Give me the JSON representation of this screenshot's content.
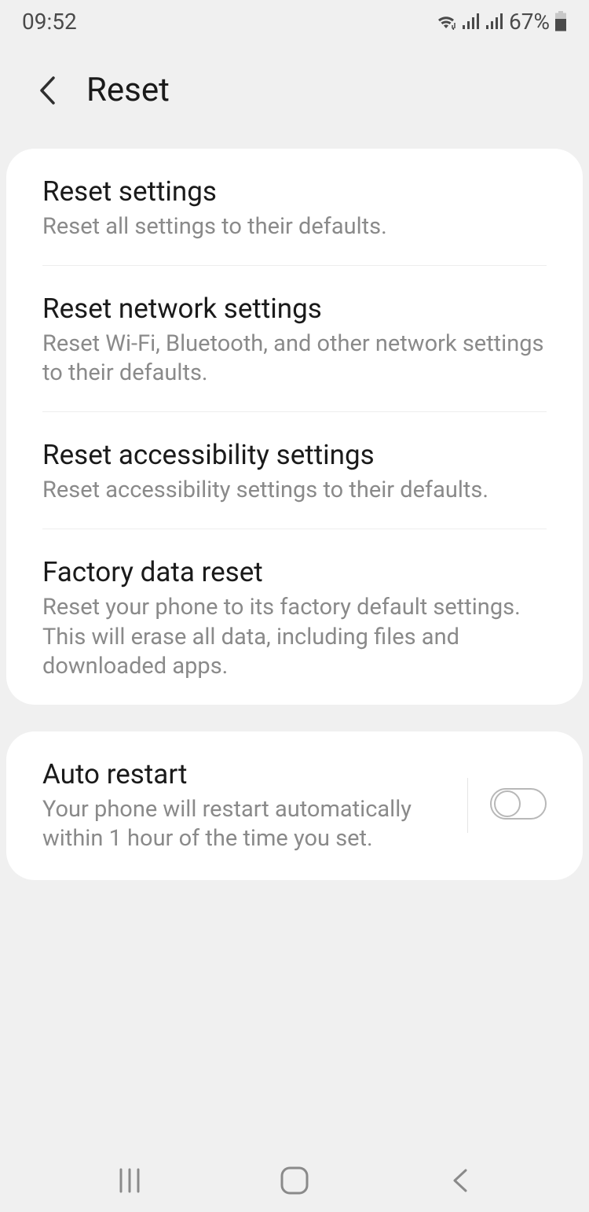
{
  "status": {
    "time": "09:52",
    "battery": "67%"
  },
  "header": {
    "title": "Reset"
  },
  "group1": {
    "item1": {
      "title": "Reset settings",
      "desc": "Reset all settings to their defaults."
    },
    "item2": {
      "title": "Reset network settings",
      "desc": "Reset Wi-Fi, Bluetooth, and other network settings to their defaults."
    },
    "item3": {
      "title": "Reset accessibility settings",
      "desc": "Reset accessibility settings to their defaults."
    },
    "item4": {
      "title": "Factory data reset",
      "desc": "Reset your phone to its factory default settings. This will erase all data, including files and downloaded apps."
    }
  },
  "group2": {
    "item1": {
      "title": "Auto restart",
      "desc": "Your phone will restart automatically within 1 hour of the time you set.",
      "toggled": false
    }
  }
}
